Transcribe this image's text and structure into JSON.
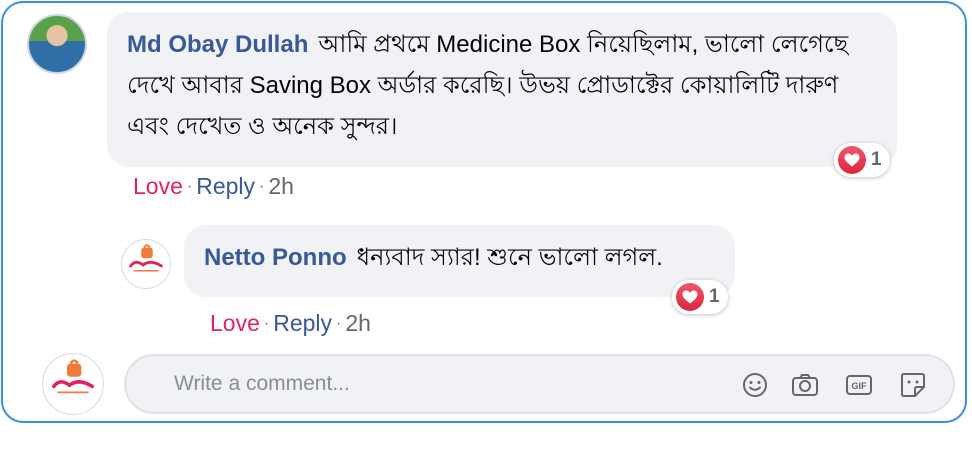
{
  "comment": {
    "author": "Md Obay Dullah",
    "text": "আমি প্রথমে Medicine Box নিয়েছিলাম, ভালো লেগেছে দেখে আবার Saving Box অর্ডার করেছি। উভয় প্রোডাক্টের কোয়ালিটি দারুণ এবং দেখেত ও অনেক সুন্দর।",
    "reaction_count": "1",
    "actions": {
      "love": "Love",
      "reply": "Reply",
      "time": "2h",
      "separator": "·"
    }
  },
  "reply": {
    "author": "Netto Ponno",
    "text": "ধন্যবাদ স্যার! শুনে ভালো লগল.",
    "reaction_count": "1",
    "actions": {
      "love": "Love",
      "reply": "Reply",
      "time": "2h",
      "separator": "·"
    }
  },
  "composer": {
    "placeholder": "Write a comment..."
  },
  "icons": {
    "emoji": "smiley-icon",
    "camera": "camera-icon",
    "gif": "gif-icon",
    "sticker": "sticker-icon",
    "reaction": "heart-icon"
  },
  "colors": {
    "frame_border": "#3b8fe0",
    "author": "#385898",
    "love": "#e0245e",
    "bubble": "#f0f2f5",
    "heart": "#e0314b"
  }
}
